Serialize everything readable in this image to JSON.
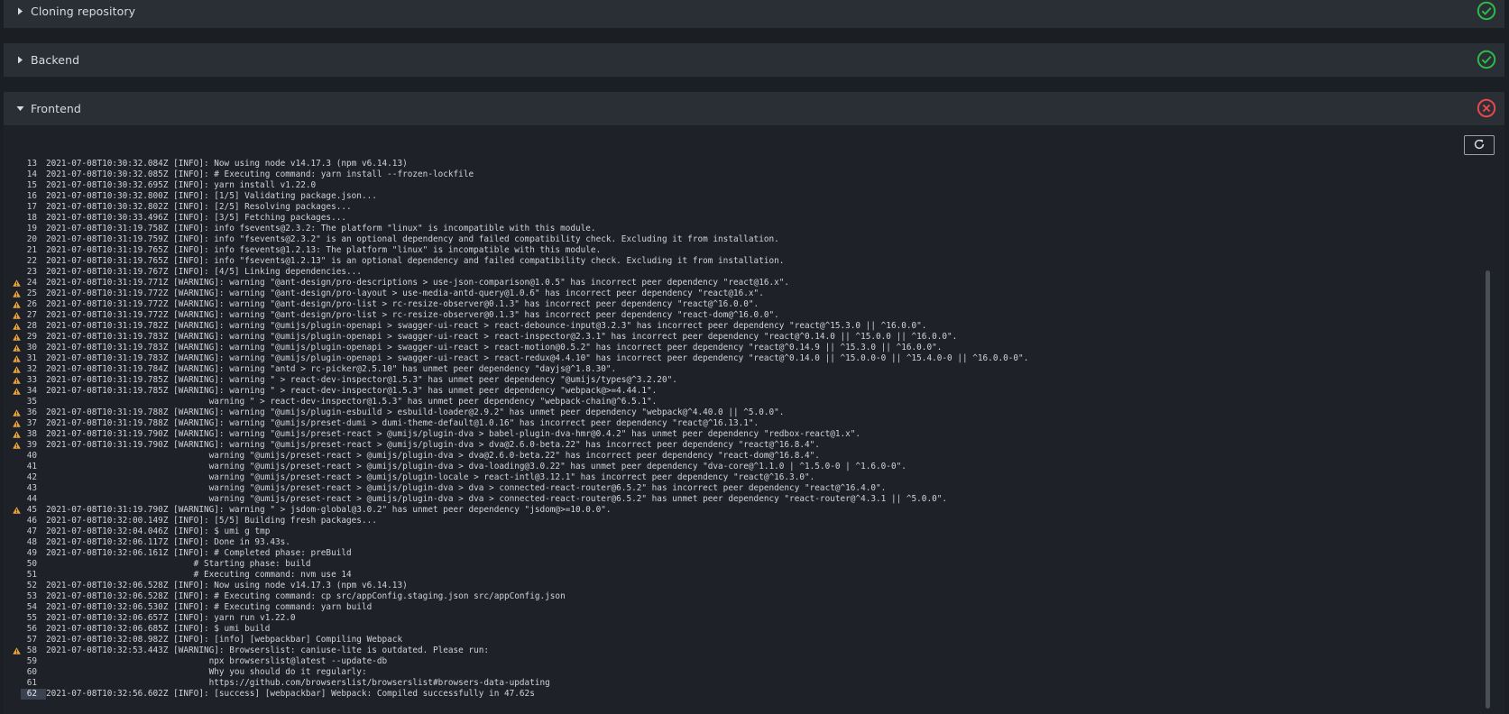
{
  "sections": {
    "clone": {
      "title": "Cloning repository",
      "status": "success"
    },
    "backend": {
      "title": "Backend",
      "status": "success"
    },
    "frontend": {
      "title": "Frontend",
      "status": "failed"
    }
  },
  "colors": {
    "success": "#2fb84a",
    "failed": "#e5484d",
    "warning": "#e8a33d"
  },
  "icons": {
    "refresh": "refresh-icon",
    "warning": "warning-icon",
    "success": "check-circle-icon",
    "failed": "x-circle-icon"
  },
  "log": {
    "active_line": "62",
    "lines": [
      {
        "n": "13",
        "w": false,
        "t": "2021-07-08T10:30:32.084Z [INFO]: Now using node v14.17.3 (npm v6.14.13)"
      },
      {
        "n": "14",
        "w": false,
        "t": "2021-07-08T10:30:32.085Z [INFO]: # Executing command: yarn install --frozen-lockfile"
      },
      {
        "n": "15",
        "w": false,
        "t": "2021-07-08T10:30:32.695Z [INFO]: yarn install v1.22.0"
      },
      {
        "n": "16",
        "w": false,
        "t": "2021-07-08T10:30:32.800Z [INFO]: [1/5] Validating package.json..."
      },
      {
        "n": "17",
        "w": false,
        "t": "2021-07-08T10:30:32.802Z [INFO]: [2/5] Resolving packages..."
      },
      {
        "n": "18",
        "w": false,
        "t": "2021-07-08T10:30:33.496Z [INFO]: [3/5] Fetching packages..."
      },
      {
        "n": "19",
        "w": false,
        "t": "2021-07-08T10:31:19.758Z [INFO]: info fsevents@2.3.2: The platform \"linux\" is incompatible with this module."
      },
      {
        "n": "20",
        "w": false,
        "t": "2021-07-08T10:31:19.759Z [INFO]: info \"fsevents@2.3.2\" is an optional dependency and failed compatibility check. Excluding it from installation."
      },
      {
        "n": "21",
        "w": false,
        "t": "2021-07-08T10:31:19.765Z [INFO]: info fsevents@1.2.13: The platform \"linux\" is incompatible with this module."
      },
      {
        "n": "22",
        "w": false,
        "t": "2021-07-08T10:31:19.765Z [INFO]: info \"fsevents@1.2.13\" is an optional dependency and failed compatibility check. Excluding it from installation."
      },
      {
        "n": "23",
        "w": false,
        "t": "2021-07-08T10:31:19.767Z [INFO]: [4/5] Linking dependencies..."
      },
      {
        "n": "24",
        "w": true,
        "t": "2021-07-08T10:31:19.771Z [WARNING]: warning \"@ant-design/pro-descriptions > use-json-comparison@1.0.5\" has incorrect peer dependency \"react@16.x\"."
      },
      {
        "n": "25",
        "w": true,
        "t": "2021-07-08T10:31:19.772Z [WARNING]: warning \"@ant-design/pro-layout > use-media-antd-query@1.0.6\" has incorrect peer dependency \"react@16.x\"."
      },
      {
        "n": "26",
        "w": true,
        "t": "2021-07-08T10:31:19.772Z [WARNING]: warning \"@ant-design/pro-list > rc-resize-observer@0.1.3\" has incorrect peer dependency \"react@^16.0.0\"."
      },
      {
        "n": "27",
        "w": true,
        "t": "2021-07-08T10:31:19.772Z [WARNING]: warning \"@ant-design/pro-list > rc-resize-observer@0.1.3\" has incorrect peer dependency \"react-dom@^16.0.0\"."
      },
      {
        "n": "28",
        "w": true,
        "t": "2021-07-08T10:31:19.782Z [WARNING]: warning \"@umijs/plugin-openapi > swagger-ui-react > react-debounce-input@3.2.3\" has incorrect peer dependency \"react@^15.3.0 || ^16.0.0\"."
      },
      {
        "n": "29",
        "w": true,
        "t": "2021-07-08T10:31:19.783Z [WARNING]: warning \"@umijs/plugin-openapi > swagger-ui-react > react-inspector@2.3.1\" has incorrect peer dependency \"react@^0.14.0 || ^15.0.0 || ^16.0.0\"."
      },
      {
        "n": "30",
        "w": true,
        "t": "2021-07-08T10:31:19.783Z [WARNING]: warning \"@umijs/plugin-openapi > swagger-ui-react > react-motion@0.5.2\" has incorrect peer dependency \"react@^0.14.9 || ^15.3.0 || ^16.0.0\"."
      },
      {
        "n": "31",
        "w": true,
        "t": "2021-07-08T10:31:19.783Z [WARNING]: warning \"@umijs/plugin-openapi > swagger-ui-react > react-redux@4.4.10\" has incorrect peer dependency \"react@^0.14.0 || ^15.0.0-0 || ^15.4.0-0 || ^16.0.0-0\"."
      },
      {
        "n": "32",
        "w": true,
        "t": "2021-07-08T10:31:19.784Z [WARNING]: warning \"antd > rc-picker@2.5.10\" has unmet peer dependency \"dayjs@^1.8.30\"."
      },
      {
        "n": "33",
        "w": true,
        "t": "2021-07-08T10:31:19.785Z [WARNING]: warning \" > react-dev-inspector@1.5.3\" has unmet peer dependency \"@umijs/types@^3.2.20\"."
      },
      {
        "n": "34",
        "w": true,
        "t": "2021-07-08T10:31:19.785Z [WARNING]: warning \" > react-dev-inspector@1.5.3\" has unmet peer dependency \"webpack@>=4.44.1\"."
      },
      {
        "n": "35",
        "w": false,
        "t": "                                warning \" > react-dev-inspector@1.5.3\" has unmet peer dependency \"webpack-chain@^6.5.1\"."
      },
      {
        "n": "36",
        "w": true,
        "t": "2021-07-08T10:31:19.788Z [WARNING]: warning \"@umijs/plugin-esbuild > esbuild-loader@2.9.2\" has unmet peer dependency \"webpack@^4.40.0 || ^5.0.0\"."
      },
      {
        "n": "37",
        "w": true,
        "t": "2021-07-08T10:31:19.788Z [WARNING]: warning \"@umijs/preset-dumi > dumi-theme-default@1.0.16\" has incorrect peer dependency \"react@^16.13.1\"."
      },
      {
        "n": "38",
        "w": true,
        "t": "2021-07-08T10:31:19.790Z [WARNING]: warning \"@umijs/preset-react > @umijs/plugin-dva > babel-plugin-dva-hmr@0.4.2\" has unmet peer dependency \"redbox-react@1.x\"."
      },
      {
        "n": "39",
        "w": true,
        "t": "2021-07-08T10:31:19.790Z [WARNING]: warning \"@umijs/preset-react > @umijs/plugin-dva > dva@2.6.0-beta.22\" has incorrect peer dependency \"react@^16.8.4\"."
      },
      {
        "n": "40",
        "w": false,
        "t": "                                warning \"@umijs/preset-react > @umijs/plugin-dva > dva@2.6.0-beta.22\" has incorrect peer dependency \"react-dom@^16.8.4\"."
      },
      {
        "n": "41",
        "w": false,
        "t": "                                warning \"@umijs/preset-react > @umijs/plugin-dva > dva-loading@3.0.22\" has unmet peer dependency \"dva-core@^1.1.0 | ^1.5.0-0 | ^1.6.0-0\"."
      },
      {
        "n": "42",
        "w": false,
        "t": "                                warning \"@umijs/preset-react > @umijs/plugin-locale > react-intl@3.12.1\" has incorrect peer dependency \"react@^16.3.0\"."
      },
      {
        "n": "43",
        "w": false,
        "t": "                                warning \"@umijs/preset-react > @umijs/plugin-dva > dva > connected-react-router@6.5.2\" has incorrect peer dependency \"react@^16.4.0\"."
      },
      {
        "n": "44",
        "w": false,
        "t": "                                warning \"@umijs/preset-react > @umijs/plugin-dva > dva > connected-react-router@6.5.2\" has unmet peer dependency \"react-router@^4.3.1 || ^5.0.0\"."
      },
      {
        "n": "45",
        "w": true,
        "t": "2021-07-08T10:31:19.790Z [WARNING]: warning \" > jsdom-global@3.0.2\" has unmet peer dependency \"jsdom@>=10.0.0\"."
      },
      {
        "n": "46",
        "w": false,
        "t": "2021-07-08T10:32:00.149Z [INFO]: [5/5] Building fresh packages..."
      },
      {
        "n": "47",
        "w": false,
        "t": "2021-07-08T10:32:04.046Z [INFO]: $ umi g tmp"
      },
      {
        "n": "48",
        "w": false,
        "t": "2021-07-08T10:32:06.117Z [INFO]: Done in 93.43s."
      },
      {
        "n": "49",
        "w": false,
        "t": "2021-07-08T10:32:06.161Z [INFO]: # Completed phase: preBuild"
      },
      {
        "n": "50",
        "w": false,
        "t": "                             # Starting phase: build"
      },
      {
        "n": "51",
        "w": false,
        "t": "                             # Executing command: nvm use 14"
      },
      {
        "n": "52",
        "w": false,
        "t": "2021-07-08T10:32:06.528Z [INFO]: Now using node v14.17.3 (npm v6.14.13)"
      },
      {
        "n": "53",
        "w": false,
        "t": "2021-07-08T10:32:06.528Z [INFO]: # Executing command: cp src/appConfig.staging.json src/appConfig.json"
      },
      {
        "n": "54",
        "w": false,
        "t": "2021-07-08T10:32:06.530Z [INFO]: # Executing command: yarn build"
      },
      {
        "n": "55",
        "w": false,
        "t": "2021-07-08T10:32:06.657Z [INFO]: yarn run v1.22.0"
      },
      {
        "n": "56",
        "w": false,
        "t": "2021-07-08T10:32:06.685Z [INFO]: $ umi build"
      },
      {
        "n": "57",
        "w": false,
        "t": "2021-07-08T10:32:08.982Z [INFO]: [info] [webpackbar] Compiling Webpack"
      },
      {
        "n": "58",
        "w": true,
        "t": "2021-07-08T10:32:53.443Z [WARNING]: Browserslist: caniuse-lite is outdated. Please run:"
      },
      {
        "n": "59",
        "w": false,
        "t": "                                npx browserslist@latest --update-db"
      },
      {
        "n": "60",
        "w": false,
        "t": "                                Why you should do it regularly:"
      },
      {
        "n": "61",
        "w": false,
        "t": "                                https://github.com/browserslist/browserslist#browsers-data-updating"
      },
      {
        "n": "62",
        "w": false,
        "t": "2021-07-08T10:32:56.602Z [INFO]: [success] [webpackbar] Webpack: Compiled successfully in 47.62s"
      }
    ]
  }
}
